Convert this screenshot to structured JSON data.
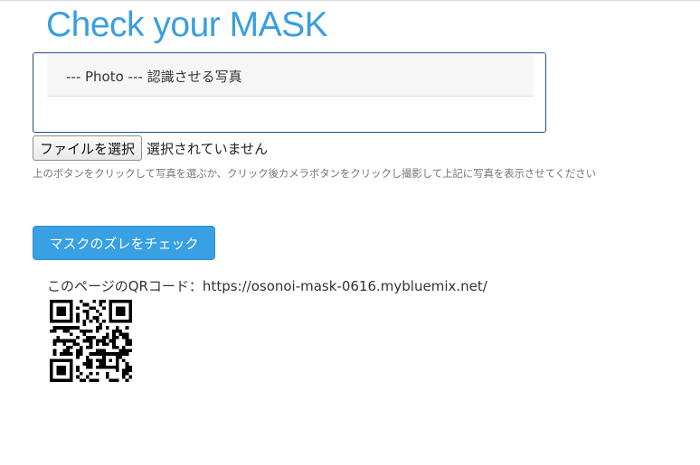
{
  "page": {
    "title": "Check your MASK"
  },
  "photo_panel": {
    "heading": "--- Photo --- 認識させる写真"
  },
  "file_input": {
    "button_label": "ファイルを選択",
    "status": "選択されていません"
  },
  "help_text": "上のボタンをクリックして写真を選ぶか、クリック後カメラボタンをクリックし撮影して上記に写真を表示させてください",
  "check_button": {
    "label": "マスクのズレをチェック"
  },
  "qr": {
    "caption": "このページのQRコード：https://osonoi-mask-0616.mybluemix.net/"
  },
  "colors": {
    "title": "#3a9ee0",
    "primary_button": "#38a0e3",
    "panel_border": "#1d4f82",
    "help_text": "#777777"
  },
  "icons": {
    "qr": "qr-code-icon"
  }
}
